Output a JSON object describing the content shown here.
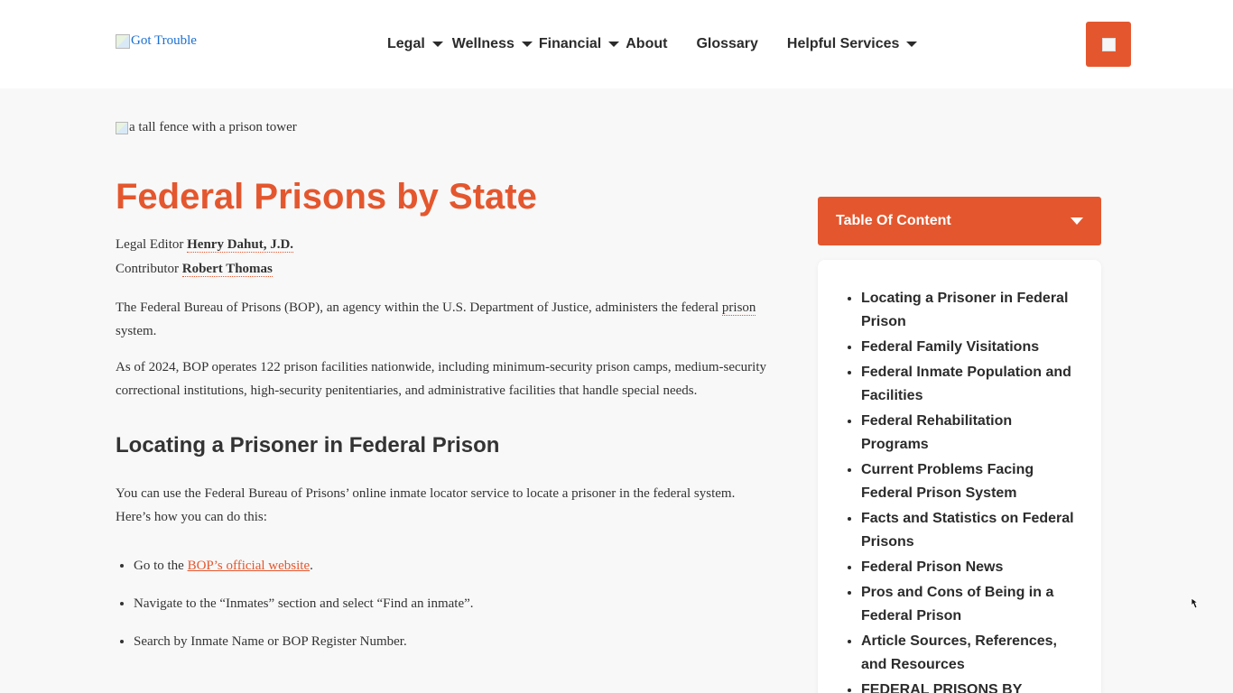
{
  "header": {
    "logo_alt": "Got Trouble",
    "nav": [
      {
        "label": "Legal",
        "has_dropdown": true
      },
      {
        "label": "Wellness",
        "has_dropdown": true
      },
      {
        "label": "Financial",
        "has_dropdown": true
      },
      {
        "label": "About",
        "has_dropdown": false
      },
      {
        "label": "Glossary",
        "has_dropdown": false
      },
      {
        "label": "Helpful Services",
        "has_dropdown": true
      }
    ],
    "cta_icon": "broken-image-icon"
  },
  "hero": {
    "image_alt": "a tall fence with a prison tower"
  },
  "article": {
    "title": "Federal Prisons by State",
    "legal_editor_label": "Legal Editor",
    "legal_editor_name": "Henry Dahut, J.D.",
    "contributor_label": "Contributor",
    "contributor_name": "Robert Thomas",
    "p1_before": "The Federal Bureau of Prisons (BOP), an agency within the U.S. Department of Justice, administers the federal ",
    "p1_term": "prison",
    "p1_after": " system.",
    "p2": "As of 2024, BOP operates 122 prison facilities nationwide, including minimum-security prison camps, medium-security correctional institutions, high-security penitentiaries, and administrative facilities that handle special needs.",
    "h2": "Locating a Prisoner in Federal Prison",
    "p3": "You can use the Federal Bureau of Prisons’ online inmate locator service to locate a prisoner in the federal system. Here’s how you can do this:",
    "step1_before": "Go to the ",
    "step1_link": "BOP’s official website",
    "step1_after": ".",
    "step2": "Navigate to the “Inmates” section and select “Find an inmate”.",
    "step3": "Search by Inmate Name or BOP Register Number."
  },
  "toc": {
    "title": "Table Of Content",
    "items": [
      "Locating a Prisoner in Federal Prison",
      "Federal Family Visitations",
      "Federal Inmate Population and Facilities",
      "Federal Rehabilitation Programs",
      "Current Problems Facing Federal Prison System",
      "Facts and Statistics on Federal Prisons",
      "Federal Prison News",
      "Pros and Cons of Being in a Federal Prison",
      "Article Sources, References, and Resources",
      "FEDERAL PRISONS BY"
    ]
  },
  "colors": {
    "accent": "#e4572e",
    "text": "#333333",
    "page_bg": "#f8f8f8",
    "link": "#1a6fd1"
  }
}
